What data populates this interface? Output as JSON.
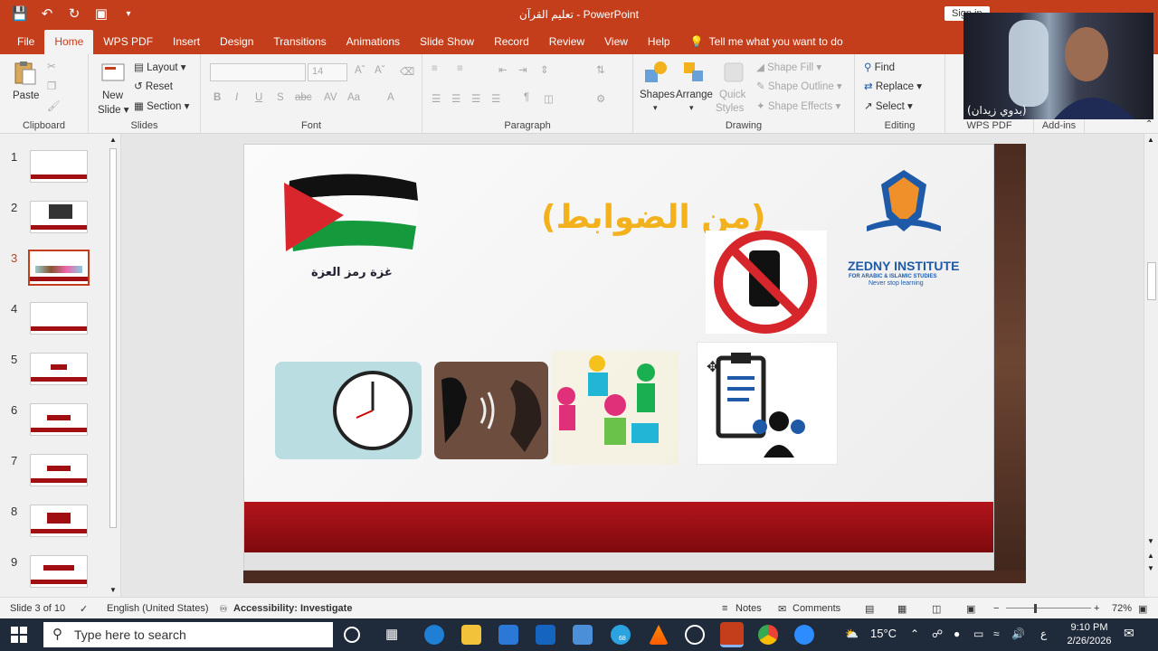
{
  "titlebar": {
    "doc_name": "تعليم القرآن",
    "separator": " - ",
    "app_name": "PowerPoint",
    "signin": "Sign in"
  },
  "tabs": [
    "File",
    "Home",
    "WPS PDF",
    "Insert",
    "Design",
    "Transitions",
    "Animations",
    "Slide Show",
    "Record",
    "Review",
    "View",
    "Help"
  ],
  "active_tab": "Home",
  "tell_me": "Tell me what you want to do",
  "ribbon": {
    "clipboard": {
      "label": "Clipboard",
      "paste": "Paste"
    },
    "slides": {
      "label": "Slides",
      "new_slide_1": "New",
      "new_slide_2": "Slide",
      "layout": "Layout",
      "reset": "Reset",
      "section": "Section"
    },
    "font": {
      "label": "Font",
      "size": "14"
    },
    "paragraph": {
      "label": "Paragraph"
    },
    "drawing": {
      "label": "Drawing",
      "shapes": "Shapes",
      "arrange": "Arrange",
      "quick_styles_1": "Quick",
      "quick_styles_2": "Styles",
      "shape_fill": "Shape Fill",
      "shape_outline": "Shape Outline",
      "shape_effects": "Shape Effects"
    },
    "editing": {
      "label": "Editing",
      "find": "Find",
      "replace": "Replace",
      "select": "Select"
    },
    "wps_pdf": {
      "label": "WPS PDF"
    },
    "addins": {
      "label": "Add-ins"
    }
  },
  "slides_panel": {
    "numbers": [
      "1",
      "2",
      "3",
      "4",
      "5",
      "6",
      "7",
      "8",
      "9"
    ],
    "selected": 3
  },
  "slide": {
    "title": "(من الضوابط)",
    "flag_caption": "غزة رمز العزة",
    "logo_name": "ZEDNY INSTITUTE",
    "logo_sub": "FOR ARABIC & ISLAMIC STUDIES",
    "logo_tagline": "Never stop learning"
  },
  "webcam": {
    "name": "(بدوي زيدان)"
  },
  "statusbar": {
    "slide_of": "Slide 3 of 10",
    "language": "English (United States)",
    "accessibility": "Accessibility: Investigate",
    "notes": "Notes",
    "comments": "Comments",
    "zoom": "72%"
  },
  "taskbar": {
    "search_placeholder": "Type here to search",
    "weather": "15°C",
    "telegram_badge": "68",
    "lang": "ع",
    "time": "9:10 PM",
    "date": "2/26/2026"
  },
  "colors": {
    "accent": "#c43e1c",
    "slide_title": "#f3b21d",
    "band_red": "#b2141a",
    "logo_blue": "#1e5aa8"
  }
}
